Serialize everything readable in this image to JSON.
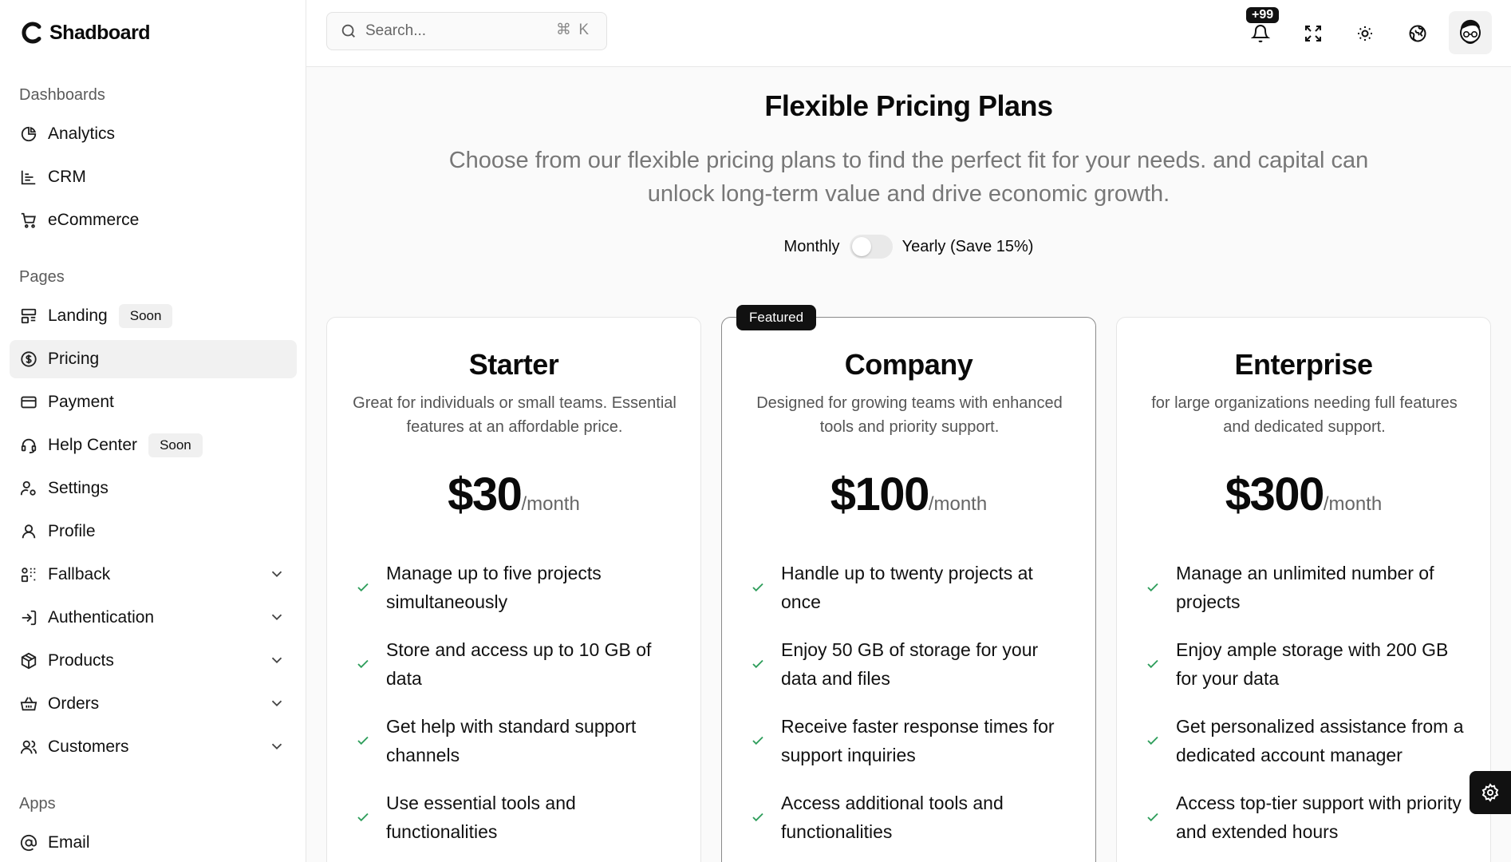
{
  "app": {
    "name": "Shadboard"
  },
  "search": {
    "placeholder": "Search...",
    "shortcut": "⌘ K"
  },
  "header": {
    "notifications_count": "+99"
  },
  "sidebar": {
    "sections": [
      {
        "label": "Dashboards"
      },
      {
        "label": "Pages"
      },
      {
        "label": "Apps"
      }
    ],
    "items": [
      {
        "label": "Analytics",
        "icon": "chart-pie-icon"
      },
      {
        "label": "CRM",
        "icon": "chart-bar-icon"
      },
      {
        "label": "eCommerce",
        "icon": "shopping-cart-icon"
      },
      {
        "label": "Landing",
        "icon": "layout-icon",
        "badge": "Soon"
      },
      {
        "label": "Pricing",
        "icon": "dollar-circle-icon",
        "active": true
      },
      {
        "label": "Payment",
        "icon": "credit-card-icon"
      },
      {
        "label": "Help Center",
        "icon": "headset-icon",
        "badge": "Soon"
      },
      {
        "label": "Settings",
        "icon": "user-cog-icon"
      },
      {
        "label": "Profile",
        "icon": "user-icon"
      },
      {
        "label": "Fallback",
        "icon": "fallback-icon",
        "expandable": true
      },
      {
        "label": "Authentication",
        "icon": "log-in-icon",
        "expandable": true
      },
      {
        "label": "Products",
        "icon": "package-icon",
        "expandable": true
      },
      {
        "label": "Orders",
        "icon": "basket-icon",
        "expandable": true
      },
      {
        "label": "Customers",
        "icon": "users-icon",
        "expandable": true
      },
      {
        "label": "Email",
        "icon": "at-sign-icon"
      }
    ]
  },
  "pricing": {
    "title": "Flexible Pricing Plans",
    "subtitle": "Choose from our flexible pricing plans to find the perfect fit for your needs. and capital can unlock long-term value and drive economic growth.",
    "billing": {
      "monthly_label": "Monthly",
      "yearly_label": "Yearly (Save 15%)",
      "yearly_selected": false
    },
    "plans": [
      {
        "name": "Starter",
        "description": "Great for individuals or small teams. Essential features at an affordable price.",
        "price": "$30",
        "period": "/month",
        "features": [
          "Manage up to five projects simultaneously",
          "Store and access up to 10 GB of data",
          "Get help with standard support channels",
          "Use essential tools and functionalities"
        ]
      },
      {
        "name": "Company",
        "featured_label": "Featured",
        "description": "Designed for growing teams with enhanced tools and priority support.",
        "price": "$100",
        "period": "/month",
        "features": [
          "Handle up to twenty projects at once",
          "Enjoy 50 GB of storage for your data and files",
          "Receive faster response times for support inquiries",
          "Access additional tools and functionalities"
        ]
      },
      {
        "name": "Enterprise",
        "description": "for large organizations needing full features and dedicated support.",
        "price": "$300",
        "period": "/month",
        "features": [
          "Manage an unlimited number of projects",
          "Enjoy ample storage with 200 GB for your data",
          "Get personalized assistance from a dedicated account manager",
          "Access top-tier support with priority and extended hours"
        ]
      }
    ]
  },
  "colors": {
    "accent": "#111111",
    "check": "#2f9e5c",
    "background": "#fafafa"
  }
}
